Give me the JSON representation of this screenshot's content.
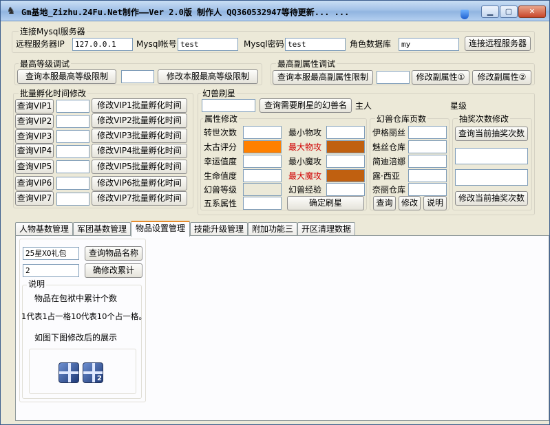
{
  "window": {
    "title": "Gm基地_Zizhu.24Fu.Net制作——Ver 2.0版  制作人 QQ360532947等待更新... ...",
    "min": "0",
    "max": "1",
    "close": "r"
  },
  "mysql": {
    "group": "连接Mysql服务器",
    "host_label": "远程服务器IP",
    "host": "127.0.0.1",
    "user_label": "Mysql帐号",
    "user": "test",
    "pwd_label": "Mysql密码",
    "pwd": "test",
    "db_label": "角色数据库",
    "db": "my",
    "connect": "连接远程服务器"
  },
  "maxlevel": {
    "group": "最高等级调试",
    "query": "查询本服最高等级限制",
    "value": "",
    "modify": "修改本服最高等级限制"
  },
  "maxattr": {
    "group": "最高副属性调试",
    "query": "查询本服最高副属性限制",
    "value": "",
    "modify1": "修改副属性①",
    "modify2": "修改副属性②"
  },
  "vip": {
    "group": "批量孵化时间修改",
    "rows": [
      {
        "query": "查询VIP1",
        "value": "",
        "modify": "修改VIP1批量孵化时间"
      },
      {
        "query": "查询VIP2",
        "value": "",
        "modify": "修改VIP2批量孵化时间"
      },
      {
        "query": "查询VIP3",
        "value": "",
        "modify": "修改VIP3批量孵化时间"
      },
      {
        "query": "查询VIP4",
        "value": "",
        "modify": "修改VIP4批量孵化时间"
      },
      {
        "query": "查询VIP5",
        "value": "",
        "modify": "修改VIP5批量孵化时间"
      },
      {
        "query": "查询VIP6",
        "value": "",
        "modify": "修改VIP6批量孵化时间"
      },
      {
        "query": "查询VIP7",
        "value": "",
        "modify": "修改VIP7批量孵化时间"
      }
    ]
  },
  "pet": {
    "group": "幻兽刷星",
    "name_value": "",
    "query": "查询需要刷星的幻兽名",
    "owner": "主人",
    "star": "星级",
    "attr_group": "属性修改",
    "attrs_left": [
      "转世次数",
      "太古评分",
      "幸运值度",
      "生命值度",
      "幻兽等级",
      "五系属性"
    ],
    "attrs_right": [
      "最小物攻",
      "最大物攻",
      "最小魔攻",
      "最大魔攻",
      "幻兽经验"
    ],
    "confirm": "确定刷星",
    "warehouse_group": "幻兽仓库页数",
    "warehouses": [
      "伊格丽丝",
      "魅丝仓库",
      "简迪涪娜",
      "露·西亚",
      "奈丽仓库"
    ],
    "wh_query": "查询",
    "wh_modify": "修改",
    "wh_help": "说明",
    "colors": {
      "orange": "#ff8000",
      "brown": "#c06010",
      "red_text": "#d00000"
    }
  },
  "lottery": {
    "group": "抽奖次数修改",
    "query": "查询当前抽奖次数",
    "modify": "修改当前抽奖次数"
  },
  "tabs": [
    {
      "label": "人物基数管理"
    },
    {
      "label": "军团基数管理"
    },
    {
      "label": "物品设置管理"
    },
    {
      "label": "技能升级管理"
    },
    {
      "label": "附加功能三"
    },
    {
      "label": "开区清理数据"
    }
  ],
  "item": {
    "name_value": "25星XO礼包",
    "query": "查询物品名称",
    "count_value": "2",
    "confirm": "确修改累计",
    "help_group": "说明",
    "help1": "物品在包袱中累计个数",
    "help2": "1代表1占一格10代表10个占一格。",
    "help3": "如图下图修改后的展示",
    "gift_count": "2"
  }
}
